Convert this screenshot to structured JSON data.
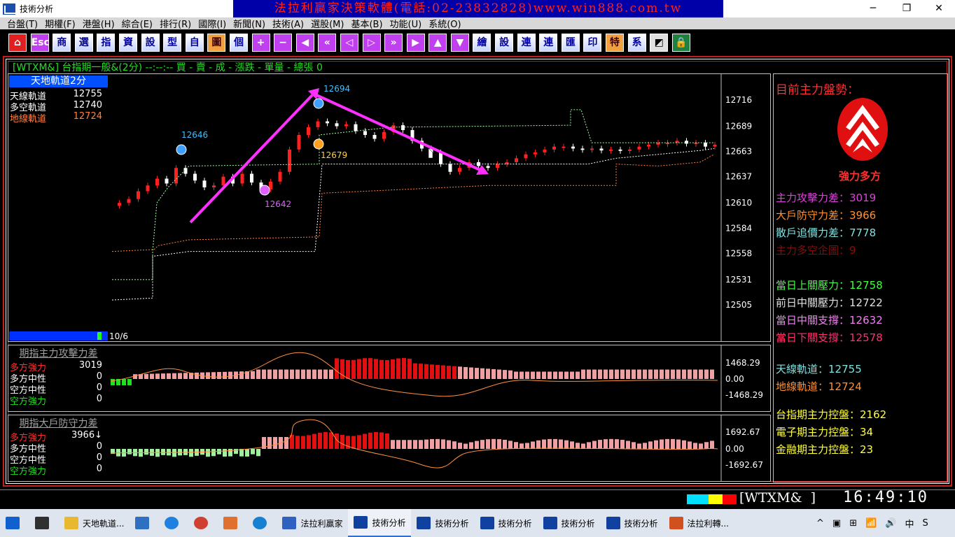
{
  "window": {
    "title": "技術分析",
    "banner": "法拉利贏家決策軟體(電話:02-23832828)www.win888.com.tw",
    "controls": [
      "─",
      "❐",
      "✕"
    ]
  },
  "menu": [
    "台盤(T)",
    "期權(F)",
    "港盤(H)",
    "綜合(E)",
    "排行(R)",
    "國際(I)",
    "新聞(N)",
    "技術(A)",
    "選股(M)",
    "基本(B)",
    "功能(U)",
    "系統(O)"
  ],
  "toolbar": [
    {
      "label": "⌂",
      "style": "red"
    },
    {
      "label": "Esc",
      "style": "purple"
    },
    {
      "label": "商",
      "style": ""
    },
    {
      "label": "選",
      "style": ""
    },
    {
      "label": "指",
      "style": ""
    },
    {
      "label": "資",
      "style": ""
    },
    {
      "label": "設",
      "style": ""
    },
    {
      "label": "型",
      "style": ""
    },
    {
      "label": "自",
      "style": ""
    },
    {
      "label": "圖",
      "style": "orange"
    },
    {
      "label": "個",
      "style": ""
    },
    {
      "label": "+",
      "style": "purple"
    },
    {
      "label": "−",
      "style": "purple"
    },
    {
      "label": "◀",
      "style": "purple"
    },
    {
      "label": "«",
      "style": "purple"
    },
    {
      "label": "◁",
      "style": "purple"
    },
    {
      "label": "▷",
      "style": "purple"
    },
    {
      "label": "»",
      "style": "purple"
    },
    {
      "label": "▶",
      "style": "purple"
    },
    {
      "label": "▲",
      "style": "purple"
    },
    {
      "label": "▼",
      "style": "purple"
    },
    {
      "label": "繪",
      "style": ""
    },
    {
      "label": "設",
      "style": ""
    },
    {
      "label": "連",
      "style": ""
    },
    {
      "label": "連",
      "style": ""
    },
    {
      "label": "匯",
      "style": ""
    },
    {
      "label": "印",
      "style": ""
    },
    {
      "label": "特",
      "style": "orange"
    },
    {
      "label": "系",
      "style": ""
    },
    {
      "label": "◩",
      "style": "grey"
    },
    {
      "label": "🔒",
      "style": "green"
    }
  ],
  "header": {
    "text": "[WTXM&] 台指期一般&(2分)  --:--:-- 買 - 賣 - 成 - 漲跌 - 單量 - 總張 0"
  },
  "main": {
    "indicator_title": "天地軌道2分",
    "legend": [
      {
        "name": "天線軌道",
        "value": "12755",
        "color": "#ffffff"
      },
      {
        "name": "多空軌道",
        "value": "12740",
        "color": "#ffffff"
      },
      {
        "name": "地線軌道",
        "value": "12724",
        "color": "#ff8040"
      }
    ],
    "date_label": "10/6",
    "y_labels": [
      "12716",
      "12689",
      "12663",
      "12637",
      "12610",
      "12584",
      "12558",
      "12531",
      "12505"
    ],
    "markers": [
      {
        "label": "12694",
        "color": "#40c0ff"
      },
      {
        "label": "12646",
        "color": "#40c0ff"
      },
      {
        "label": "12679",
        "color": "#ffd040"
      },
      {
        "label": "12642",
        "color": "#e060ff"
      }
    ]
  },
  "sub1": {
    "title": "期指主力攻擊力差",
    "rows": [
      {
        "name": "多方強力",
        "value": "3019",
        "color": "#ff3030"
      },
      {
        "name": "多方中性",
        "value": "0",
        "color": "#ffffff"
      },
      {
        "name": "空方中性",
        "value": "0",
        "color": "#ffffff"
      },
      {
        "name": "空方強力",
        "value": "0",
        "color": "#20e020"
      }
    ],
    "y_labels": [
      "1468.29",
      "0.00",
      "-1468.29"
    ]
  },
  "sub2": {
    "title": "期指大戶防守力差",
    "rows": [
      {
        "name": "多方強力",
        "value": "3966↓",
        "color": "#ff3030"
      },
      {
        "name": "多方中性",
        "value": "0",
        "color": "#ffffff"
      },
      {
        "name": "空方中性",
        "value": "0",
        "color": "#ffffff"
      },
      {
        "name": "空方強力",
        "value": "0",
        "color": "#20e020"
      }
    ],
    "y_labels": [
      "1692.67",
      "0.00",
      "-1692.67"
    ]
  },
  "right": {
    "title": "目前主力盤勢：",
    "status": "強力多方",
    "rows": [
      {
        "label": "主力攻擊力差：",
        "value": "3019",
        "color": "#e040e0"
      },
      {
        "label": "大戶防守力差：",
        "value": "3966",
        "color": "#ff9030"
      },
      {
        "label": "散戶追價力差：",
        "value": "7778",
        "color": "#80e0e0"
      },
      {
        "label": "主力多空企圖：",
        "value": "9",
        "color": "#801010"
      },
      {
        "label": "當日上關壓力：",
        "value": "12758",
        "color": "#40ff40"
      },
      {
        "label": "前日中關壓力：",
        "value": "12722",
        "color": "#e0e0e0"
      },
      {
        "label": "當日中關支撐：",
        "value": "12632",
        "color": "#f080f0"
      },
      {
        "label": "當日下關支撐：",
        "value": "12578",
        "color": "#ff3070"
      },
      {
        "label": "天線軌道：",
        "value": "12755",
        "color": "#80e0e0"
      },
      {
        "label": "地線軌道：",
        "value": "12724",
        "color": "#ff9030"
      },
      {
        "label": "台指期主力控盤：",
        "value": "2162",
        "color": "#ffff40"
      },
      {
        "label": "電子期主力控盤：",
        "value": "34",
        "color": "#ffff40"
      },
      {
        "label": "金融期主力控盤：",
        "value": "23",
        "color": "#ffff40"
      }
    ]
  },
  "status": {
    "symbol": "[WTXM&  ]",
    "time": "16:49:10"
  },
  "taskbar": [
    {
      "label": "",
      "icon": "windows-icon"
    },
    {
      "label": "",
      "icon": "task-view-icon"
    },
    {
      "label": "天地軌道...",
      "icon": "folder-icon"
    },
    {
      "label": "",
      "icon": "laptop-icon"
    },
    {
      "label": "",
      "icon": "ie-icon"
    },
    {
      "label": "",
      "icon": "chrome-icon"
    },
    {
      "label": "",
      "icon": "paint-icon"
    },
    {
      "label": "",
      "icon": "edge-icon"
    },
    {
      "label": "法拉利贏家",
      "icon": "ferrari-icon"
    },
    {
      "label": "技術分析",
      "icon": "chart-icon",
      "active": true
    },
    {
      "label": "技術分析",
      "icon": "chart-icon"
    },
    {
      "label": "技術分析",
      "icon": "chart-icon"
    },
    {
      "label": "技術分析",
      "icon": "chart-icon"
    },
    {
      "label": "技術分析",
      "icon": "chart-icon"
    },
    {
      "label": "法拉利轉...",
      "icon": "ppt-icon"
    }
  ],
  "tray": {
    "items": [
      "^",
      "▣",
      "⊞",
      "📶",
      "🔊",
      "中",
      "S"
    ],
    "notify": "💬"
  }
}
